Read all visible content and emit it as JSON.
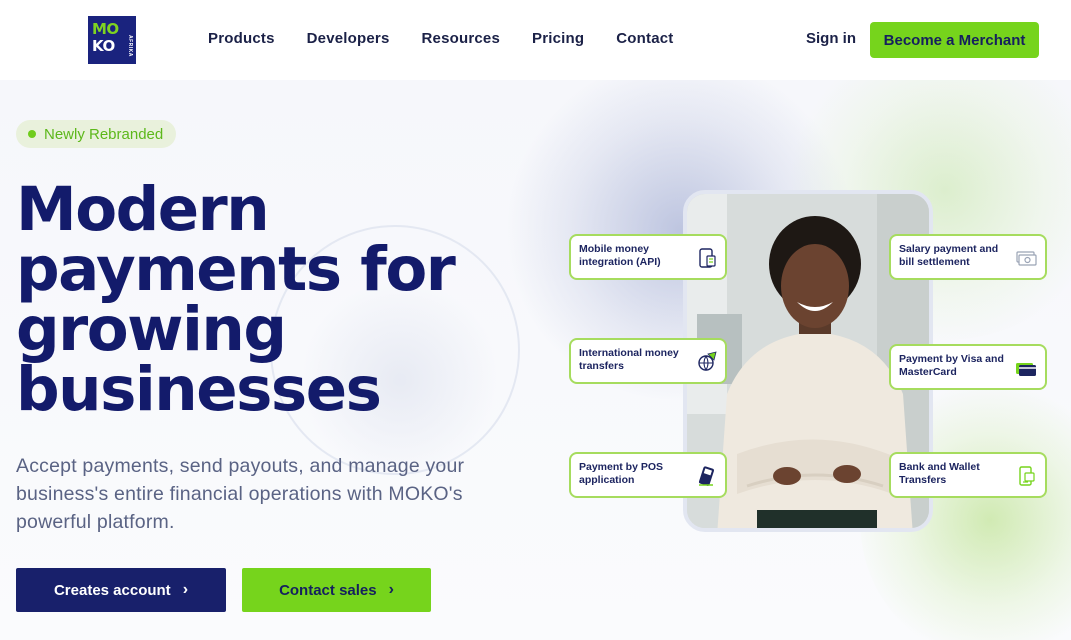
{
  "brand": {
    "logo_line1": "MO",
    "logo_line2": "KO",
    "logo_side": "AFRIKA",
    "primary_color": "#18206b",
    "accent_color": "#76d41c"
  },
  "nav": {
    "items": [
      "Products",
      "Developers",
      "Resources",
      "Pricing",
      "Contact"
    ],
    "sign_in": "Sign in",
    "become_merchant": "Become a Merchant"
  },
  "hero": {
    "badge": "Newly Rebranded",
    "headline_line1": "Modern",
    "headline_line2": "payments for",
    "headline_line3": "growing",
    "headline_line4": "businesses",
    "subtitle": "Accept payments, send payouts, and manage your business's entire financial operations with MOKO's powerful platform.",
    "cta_primary": "Creates account",
    "cta_secondary": "Contact sales"
  },
  "features": [
    {
      "label": "Mobile money integration (API)",
      "icon": "phone-document-icon"
    },
    {
      "label": "International money transfers",
      "icon": "globe-plane-icon"
    },
    {
      "label": "Payment by POS application",
      "icon": "pos-terminal-icon"
    },
    {
      "label": "Salary payment and bill settlement",
      "icon": "cash-bills-icon"
    },
    {
      "label": "Payment by Visa and MasterCard",
      "icon": "credit-card-icon"
    },
    {
      "label": "Bank and Wallet Transfers",
      "icon": "wallet-transfer-icon"
    }
  ]
}
